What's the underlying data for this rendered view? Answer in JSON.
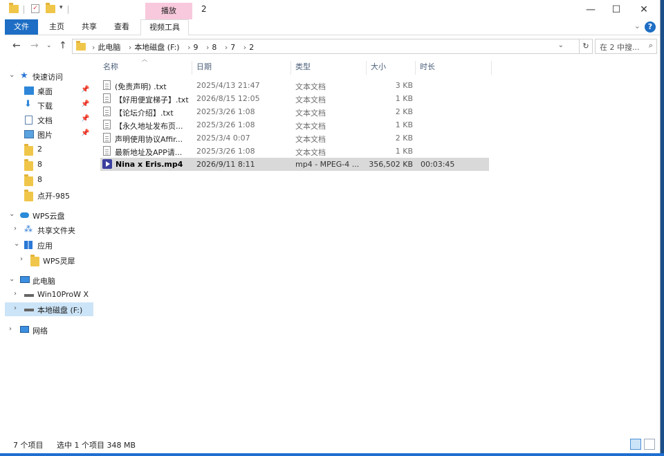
{
  "window": {
    "title": "2",
    "context_tab": "播放",
    "controls": {
      "minimize": "—",
      "maximize": "☐",
      "close": "✕"
    }
  },
  "ribbon": {
    "tabs": [
      "文件",
      "主页",
      "共享",
      "查看",
      "视频工具"
    ],
    "help": "?"
  },
  "address": {
    "path": [
      "此电脑",
      "本地磁盘 (F:)",
      "9",
      "8",
      "7",
      "2"
    ],
    "search_placeholder": "在 2 中搜..."
  },
  "sidebar": {
    "items": [
      {
        "label": "快速访问",
        "icon": "star-icon",
        "pinned": false
      },
      {
        "label": "桌面",
        "icon": "desktop-icon",
        "pinned": true
      },
      {
        "label": "下载",
        "icon": "download-icon",
        "pinned": true
      },
      {
        "label": "文档",
        "icon": "document-icon",
        "pinned": true
      },
      {
        "label": "图片",
        "icon": "picture-icon",
        "pinned": true
      },
      {
        "label": "2",
        "icon": "folder-icon",
        "pinned": false
      },
      {
        "label": "8",
        "icon": "folder-icon",
        "pinned": false
      },
      {
        "label": "8",
        "icon": "folder-icon",
        "pinned": false
      },
      {
        "label": "点开-985",
        "icon": "folder-icon",
        "pinned": false
      },
      {
        "label": "WPS云盘",
        "icon": "cloud-icon",
        "pinned": false
      },
      {
        "label": "共享文件夹",
        "icon": "share-icon",
        "pinned": false
      },
      {
        "label": "应用",
        "icon": "apps-icon",
        "pinned": false
      },
      {
        "label": "WPS灵犀",
        "icon": "folder-icon",
        "pinned": false
      },
      {
        "label": "此电脑",
        "icon": "computer-icon",
        "pinned": false
      },
      {
        "label": "Win10ProW X",
        "icon": "drive-icon",
        "pinned": false
      },
      {
        "label": "本地磁盘 (F:)",
        "icon": "drive-icon",
        "pinned": false
      },
      {
        "label": "网络",
        "icon": "network-icon",
        "pinned": false
      }
    ]
  },
  "columns": [
    "名称",
    "日期",
    "类型",
    "大小",
    "时长"
  ],
  "files": [
    {
      "name": "(免责声明) .txt",
      "date": "2025/4/13 21:47",
      "type": "文本文档",
      "size": "3 KB",
      "duration": ""
    },
    {
      "name": "【好用便宜梯子】.txt",
      "date": "2026/8/15 12:05",
      "type": "文本文档",
      "size": "1 KB",
      "duration": ""
    },
    {
      "name": "【论坛介绍】.txt",
      "date": "2025/3/26 1:08",
      "type": "文本文档",
      "size": "2 KB",
      "duration": ""
    },
    {
      "name": "【永久地址发布页...",
      "date": "2025/3/26 1:08",
      "type": "文本文档",
      "size": "1 KB",
      "duration": ""
    },
    {
      "name": "声明使用协议Affir...",
      "date": "2025/3/4 0:07",
      "type": "文本文档",
      "size": "2 KB",
      "duration": ""
    },
    {
      "name": "最新地址及APP请...",
      "date": "2025/3/26 1:08",
      "type": "文本文档",
      "size": "1 KB",
      "duration": ""
    },
    {
      "name": "Nina x Eris.mp4",
      "date": "2026/9/11 8:11",
      "type": "mp4 - MPEG-4 ...",
      "size": "356,502 KB",
      "duration": "00:03:45"
    }
  ],
  "status": {
    "count": "7 个项目",
    "selection": "选中 1 个项目  348 MB"
  }
}
